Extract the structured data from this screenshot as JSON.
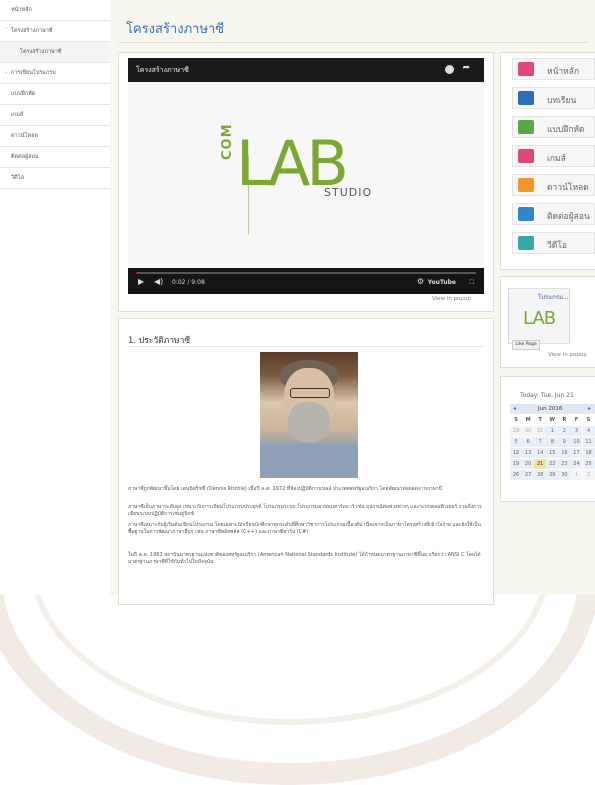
{
  "sidebar": {
    "items": [
      {
        "label": "หน้าหลัก",
        "arrow": ""
      },
      {
        "label": "โครงสร้างภาษาซี",
        "arrow": "˅"
      },
      {
        "label": "โครงสร้างภาษาซี",
        "arrow": ""
      },
      {
        "label": "การเขียนโปรแกรม",
        "arrow": "›"
      },
      {
        "label": "แบบฝึกหัด",
        "arrow": ""
      },
      {
        "label": "เกมส์",
        "arrow": ""
      },
      {
        "label": "ดาวน์โหลด",
        "arrow": ""
      },
      {
        "label": "ติดต่อผู้สอน",
        "arrow": ""
      },
      {
        "label": "วีดีโอ",
        "arrow": ""
      }
    ]
  },
  "page": {
    "title": "โครงสร้างภาษาซี"
  },
  "video": {
    "title": "โครงสร้างภาษาซี",
    "logo_com": "COM",
    "logo_lab": "LAB",
    "logo_studio": "STUDIO",
    "time": "0:02 / 9:08",
    "youtube": "YouTube",
    "progress": 0.004,
    "popup": "View in popup"
  },
  "history": {
    "title": "1. ประวัติภาษาซี",
    "paragraphs": [
      "ภาษาซีถูกพัฒนาขึ้นโดย เดนนิสริชชี่ (Dennis Ritchie) เมื่อปี ค.ศ. 1972 ที่ห้องปฏิบัติการเบลล์ ประเทศสหรัฐอเมริกา โดยพัฒนาต่อยอดจากภาษาบี",
      "ภาษาซีเป็นภาษาระดับสูง เหมาะกับการเขียนโปรแกรมประยุกต์ โปรแกรมระบบ โปรแกรมควบคุมฮาร์ดแวร์ เช่น อุปกรณ์ต่อพ่วงต่างๆ และระบบคอมพิวเตอร์ รวมถึงการเขียนระบบปฏิบัติการเช่นยูนิกซ์",
      "ภาษาซีเหมาะกับผู้เริ่มต้นเขียนโปรแกรม โดยเฉพาะนักเรียนนักศึกษาทุกระดับที่ศึกษาวิชาการโปรแกรมเบื้องต้น เนื่องจากเป็นภาษาโครงสร้างที่เข้าใจง่าย และยังใช้เป็นพื้นฐานในการพัฒนาภาษาอื่นๆ เช่น ภาษาซีพลัสพลัส (C++) และภาษาซีชาร์ป (C#)",
      "ในปี ค.ศ. 1983 สถาบันมาตรฐานแห่งชาติของสหรัฐอเมริกา (American National Standards Institute) ได้กำหนดมาตรฐานภาษาซีขึ้นมาเรียกว่า ANSI C โดยได้มาตรฐานภาษาซีที่ใช้กันทั่วไปในปัจจุบัน"
    ]
  },
  "right_nav": {
    "items": [
      {
        "label": "หน้าหลัก",
        "icon": "home-icon",
        "color": "#e0457b"
      },
      {
        "label": "บทเรียน",
        "icon": "monitor-icon",
        "color": "#2f6db5"
      },
      {
        "label": "แบบฝึกหัด",
        "icon": "document-icon",
        "color": "#5aa845"
      },
      {
        "label": "เกมส์",
        "icon": "gamepad-icon",
        "color": "#e0457b"
      },
      {
        "label": "ดาวน์โหลด",
        "icon": "download-icon",
        "color": "#f0962a"
      },
      {
        "label": "ติดต่อผู้สอน",
        "icon": "chat-icon",
        "color": "#2f86c9"
      },
      {
        "label": "วีดีโอ",
        "icon": "book-icon",
        "color": "#35a9a3"
      }
    ]
  },
  "facebook": {
    "name": "โปรแกรม...",
    "logo": "LAB",
    "like": "Like Page",
    "popup": "View in popup"
  },
  "calendar": {
    "today": "Today: Tue, Jun 21",
    "month": "Jun 2016",
    "prev": "◂",
    "next": "▸",
    "days": [
      "S",
      "M",
      "T",
      "W",
      "R",
      "F",
      "S"
    ],
    "weeks": [
      [
        "29",
        "30",
        "31",
        "1",
        "2",
        "3",
        "4"
      ],
      [
        "5",
        "6",
        "7",
        "8",
        "9",
        "10",
        "11"
      ],
      [
        "12",
        "13",
        "14",
        "15",
        "16",
        "17",
        "18"
      ],
      [
        "19",
        "20",
        "21",
        "22",
        "23",
        "24",
        "25"
      ],
      [
        "26",
        "27",
        "28",
        "29",
        "30",
        "1",
        "2"
      ]
    ],
    "today_day": "21"
  }
}
